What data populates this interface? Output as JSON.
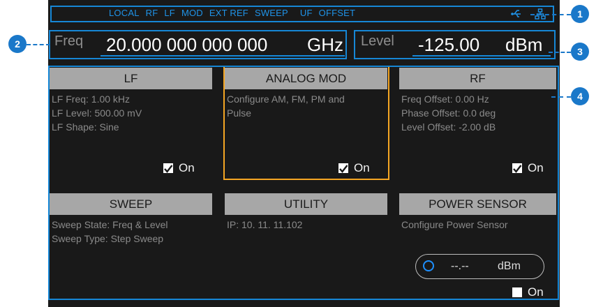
{
  "status_bar": {
    "items": [
      "LOCAL",
      "RF",
      "LF",
      "MOD",
      "EXT REF",
      "SWEEP",
      "UF",
      "OFFSET"
    ],
    "icons": [
      "usb-icon",
      "lan-icon"
    ]
  },
  "freq": {
    "label": "Freq",
    "value": "20.000 000 000 000",
    "unit": "GHz"
  },
  "level": {
    "label": "Level",
    "value": "-125.00",
    "unit": "dBm"
  },
  "cards": [
    {
      "title": "LF",
      "lines": [
        "LF Freq: 1.00 kHz",
        "LF Level: 500.00 mV",
        "LF Shape: Sine"
      ],
      "on_label": "On",
      "checked": true
    },
    {
      "title": "ANALOG MOD",
      "lines": [
        "Configure AM, FM, PM and",
        "Pulse"
      ],
      "on_label": "On",
      "checked": true,
      "selected": true
    },
    {
      "title": "RF",
      "lines": [
        "Freq Offset: 0.00 Hz",
        "Phase Offset: 0.0 deg",
        "Level Offset: -2.00 dB"
      ],
      "on_label": "On",
      "checked": true
    },
    {
      "title": "SWEEP",
      "lines": [
        "Sweep State: Freq & Level",
        "Sweep Type: Step Sweep"
      ]
    },
    {
      "title": "UTILITY",
      "lines": [
        "IP:  10. 11. 11.102"
      ]
    },
    {
      "title": "POWER SENSOR",
      "lines": [
        "Configure Power Sensor"
      ],
      "on_label": "On",
      "checked": false,
      "reading": "--.--",
      "reading_unit": "dBm"
    }
  ],
  "callouts": [
    "1",
    "2",
    "3",
    "4"
  ],
  "colors": {
    "accent_blue": "#1687d6",
    "selected_orange": "#f5a623",
    "screen_bg": "#191919",
    "card_head": "#a7a7a7"
  }
}
